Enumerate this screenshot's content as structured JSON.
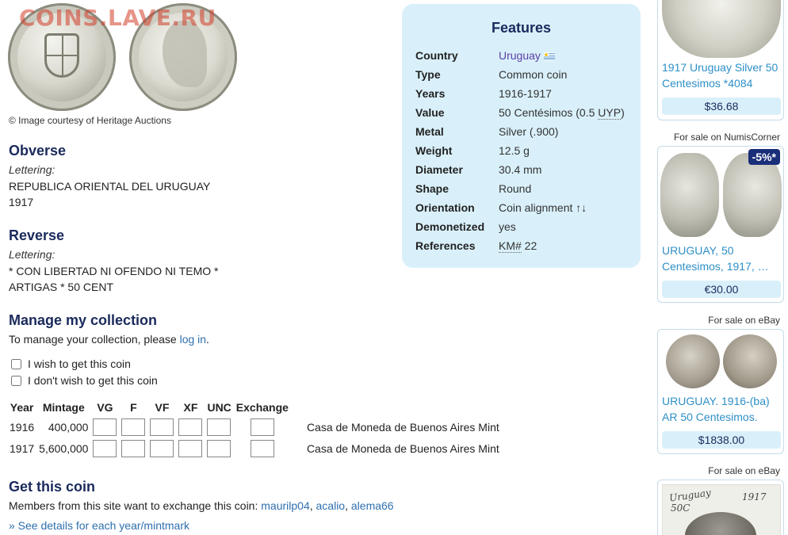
{
  "watermark": "COINS.LAVE.RU",
  "image_credit": "© Image courtesy of Heritage Auctions",
  "obverse": {
    "heading": "Obverse",
    "lettering_label": "Lettering:",
    "lines": [
      "REPUBLICA ORIENTAL DEL URUGUAY",
      "1917"
    ]
  },
  "reverse": {
    "heading": "Reverse",
    "lettering_label": "Lettering:",
    "lines": [
      "* CON LIBERTAD NI OFENDO NI TEMO *",
      "ARTIGAS * 50 CENT"
    ]
  },
  "manage": {
    "heading": "Manage my collection",
    "text": "To manage your collection, please ",
    "login_link": "log in",
    "suffix": ".",
    "wish_label": "I wish to get this coin",
    "nowish_label": "I don't wish to get this coin"
  },
  "mint_table": {
    "headers": [
      "Year",
      "Mintage",
      "VG",
      "F",
      "VF",
      "XF",
      "UNC",
      "Exchange"
    ],
    "rows": [
      {
        "year": "1916",
        "mintage": "400,000",
        "mint": "Casa de Moneda de Buenos Aires Mint"
      },
      {
        "year": "1917",
        "mintage": "5,600,000",
        "mint": "Casa de Moneda de Buenos Aires Mint"
      }
    ]
  },
  "get_coin": {
    "heading": "Get this coin",
    "text": "Members from this site want to exchange this coin: ",
    "members": [
      "maurilp04",
      "acalio",
      "alema66"
    ],
    "details_link": "» See details for each year/mintmark"
  },
  "features": {
    "title": "Features",
    "rows": [
      {
        "key": "Country",
        "value": "Uruguay"
      },
      {
        "key": "Type",
        "value": "Common coin"
      },
      {
        "key": "Years",
        "value": "1916-1917"
      },
      {
        "key": "Value",
        "value": "50 Centésimos (0.5 ",
        "value_abbr": "UYP",
        "value_suffix": ")"
      },
      {
        "key": "Metal",
        "value": "Silver (.900)"
      },
      {
        "key": "Weight",
        "value": "12.5 g"
      },
      {
        "key": "Diameter",
        "value": "30.4 mm"
      },
      {
        "key": "Shape",
        "value": "Round"
      },
      {
        "key": "Orientation",
        "value": "Coin alignment ↑↓"
      },
      {
        "key": "Demonetized",
        "value": "yes"
      },
      {
        "key": "References",
        "value_abbr": "KM#",
        "value": " 22"
      }
    ]
  },
  "listings": [
    {
      "source": "",
      "title": "1917 Uruguay Silver 50 Centesimos *4084",
      "price": "$36.68"
    },
    {
      "source": "For sale on NumisCorner",
      "badge": "-5%*",
      "title": "URUGUAY, 50 Centesimos, 1917, …",
      "price": "€30.00"
    },
    {
      "source": "For sale on eBay",
      "title": "URUGUAY. 1916-(ba) AR 50 Centesimos.",
      "price": "$1838.00"
    },
    {
      "source": "For sale on eBay",
      "title": "",
      "price": ""
    }
  ],
  "listing_photo_text": [
    "Uruguay",
    "50C",
    "1917"
  ],
  "colors": {
    "heading": "#1a2a5c",
    "link": "#2e6fae",
    "panel_bg": "#d9f0fa",
    "listing_title": "#2e8fc7",
    "badge": "#1a2f7a"
  }
}
